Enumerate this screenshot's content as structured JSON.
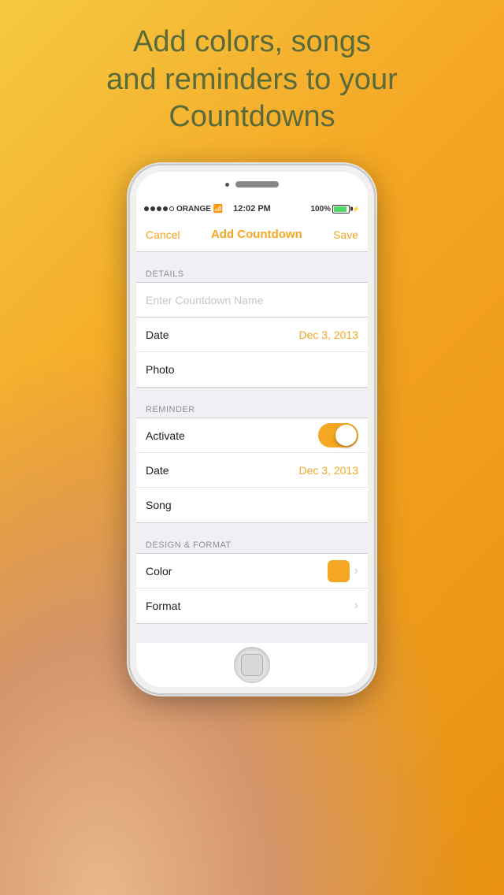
{
  "background": {
    "gradient_start": "#f5c842",
    "gradient_end": "#e8920f"
  },
  "headline": {
    "line1": "Add colors, songs",
    "line2": "and reminders to your",
    "line3": "Countdowns"
  },
  "status_bar": {
    "carrier": "ORANGE",
    "signal": "●●●●○",
    "time": "12:02 PM",
    "battery": "100%"
  },
  "nav": {
    "cancel_label": "Cancel",
    "title_label": "Add Countdown",
    "save_label": "Save"
  },
  "sections": {
    "details": {
      "header": "DETAILS",
      "name_placeholder": "Enter Countdown Name",
      "date_label": "Date",
      "date_value": "Dec 3, 2013",
      "photo_label": "Photo"
    },
    "reminder": {
      "header": "REMINDER",
      "activate_label": "Activate",
      "activate_on": true,
      "date_label": "Date",
      "date_value": "Dec 3, 2013",
      "song_label": "Song"
    },
    "design": {
      "header": "DESIGN & FORMAT",
      "color_label": "Color",
      "color_value": "#f5a623",
      "format_label": "Format"
    }
  },
  "accent_color": "#f5a623"
}
